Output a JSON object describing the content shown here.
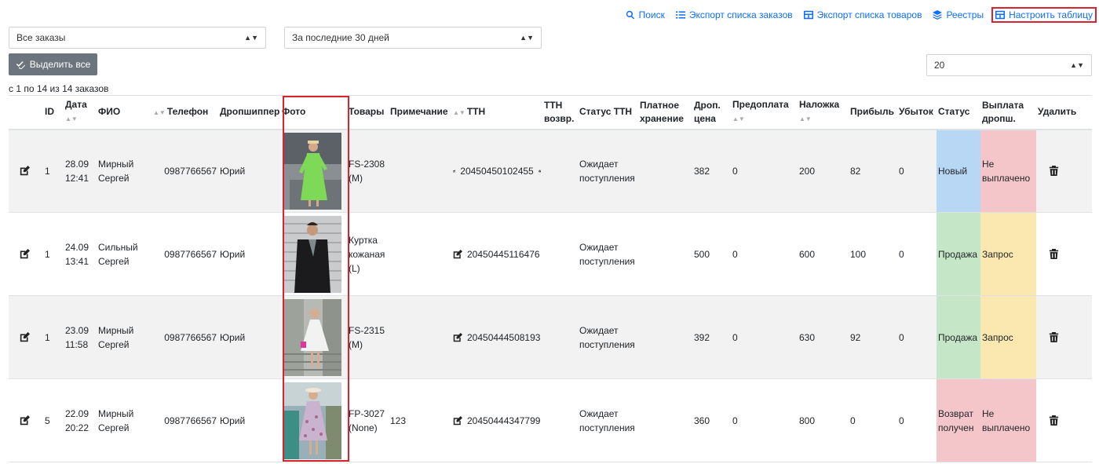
{
  "toolbar": {
    "search": "Поиск",
    "export_orders": "Экспорт списка заказов",
    "export_goods": "Экспорт списка товаров",
    "registers": "Реестры",
    "configure_table": "Настроить таблицу"
  },
  "filters": {
    "orders_value": "Все заказы",
    "period_value": "За последние 30 дней",
    "page_size": "20"
  },
  "select_all_label": "Выделить все",
  "counter_text": "с 1 по 14 из 14 заказов",
  "columns": {
    "id": "ID",
    "date": "Дата",
    "fio": "ФИО",
    "phone": "Телефон",
    "dropshipper": "Дропшиппер",
    "photo": "Фото",
    "goods": "Товары",
    "note": "Примечание",
    "ttn": "ТТН",
    "ttn_return_1": "ТТН",
    "ttn_return_2": "возвр.",
    "ttn_status": "Статус ТТН",
    "paid_storage_1": "Платное",
    "paid_storage_2": "хранение",
    "drop_price_1": "Дроп.",
    "drop_price_2": "цена",
    "prepay": "Предоплата",
    "cod": "Наложка",
    "profit": "Прибыль",
    "loss": "Убыток",
    "status": "Статус",
    "payout_1": "Выплата",
    "payout_2": "дропш.",
    "delete": "Удалить"
  },
  "rows": [
    {
      "id": "1",
      "date_1": "28.09",
      "date_2": "12:41",
      "fio_1": "Мирный",
      "fio_2": "Сергей",
      "phone": "0987766567",
      "dropshipper": "Юрий",
      "goods_1": "FS-2308",
      "goods_2": "(M)",
      "goods_3": "",
      "note": "",
      "ttn": "20450450102455",
      "ttn_status_1": "Ожидает",
      "ttn_status_2": "поступления",
      "drop_price": "382",
      "prepay": "0",
      "cod": "200",
      "profit": "82",
      "loss": "0",
      "status_1": "Новый",
      "status_2": "",
      "payout_1": "Не",
      "payout_2": "выплачено"
    },
    {
      "id": "1",
      "date_1": "24.09",
      "date_2": "13:41",
      "fio_1": "Сильный",
      "fio_2": "Сергей",
      "phone": "0987766567",
      "dropshipper": "Юрий",
      "goods_1": "Куртка",
      "goods_2": "кожаная",
      "goods_3": "(L)",
      "note": "",
      "ttn": "20450445116476",
      "ttn_status_1": "Ожидает",
      "ttn_status_2": "поступления",
      "drop_price": "500",
      "prepay": "0",
      "cod": "600",
      "profit": "100",
      "loss": "0",
      "status_1": "Продажа",
      "status_2": "",
      "payout_1": "Запрос",
      "payout_2": ""
    },
    {
      "id": "1",
      "date_1": "23.09",
      "date_2": "11:58",
      "fio_1": "Мирный",
      "fio_2": "Сергей",
      "phone": "0987766567",
      "dropshipper": "Юрий",
      "goods_1": "FS-2315",
      "goods_2": "(M)",
      "goods_3": "",
      "note": "",
      "ttn": "20450444508193",
      "ttn_status_1": "Ожидает",
      "ttn_status_2": "поступления",
      "drop_price": "392",
      "prepay": "0",
      "cod": "630",
      "profit": "92",
      "loss": "0",
      "status_1": "Продажа",
      "status_2": "",
      "payout_1": "Запрос",
      "payout_2": ""
    },
    {
      "id": "5",
      "date_1": "22.09",
      "date_2": "20:22",
      "fio_1": "Мирный",
      "fio_2": "Сергей",
      "phone": "0987766567",
      "dropshipper": "Юрий",
      "goods_1": "FP-3027",
      "goods_2": "(None)",
      "goods_3": "",
      "note": "123",
      "ttn": "20450444347799",
      "ttn_status_1": "Ожидает",
      "ttn_status_2": "поступления",
      "drop_price": "360",
      "prepay": "0",
      "cod": "800",
      "profit": "0",
      "loss": "0",
      "status_1": "Возврат",
      "status_2": "получен",
      "payout_1": "Не",
      "payout_2": "выплачено"
    }
  ],
  "icons": {
    "search": "search-icon",
    "list": "list-icon",
    "table": "table-icon",
    "layers": "layers-icon",
    "edit": "edit-icon",
    "print": "print-icon",
    "trash": "trash-icon",
    "check": "check-double-icon"
  },
  "colors": {
    "link": "#0d6efd",
    "highlight": "#d9232d",
    "status_new": "#b8d7f5",
    "status_sale": "#c6e7c7",
    "status_return": "#f4c6ca",
    "payout_no": "#f4c6ca",
    "payout_request": "#fbe8b0"
  }
}
